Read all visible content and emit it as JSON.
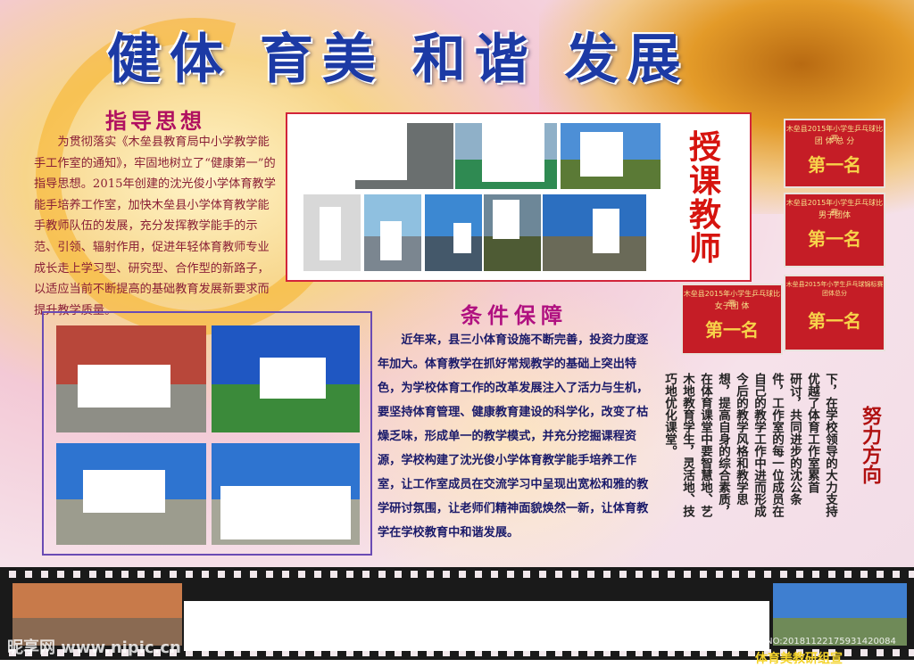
{
  "title": "健体 育美 和谐 发展",
  "guide": {
    "heading": "指导思想",
    "text": "为贯彻落实《木垒县教育局中小学教学能手工作室的通知》，牢固地树立了“健康第一”的指导思想。2015年创建的沈光俊小学体育教学能手培养工作室，加快木垒县小学体育教学能手教师队伍的发展，充分发挥教学能手的示范、引领、辐射作用，促进年轻体育教师专业成长走上学习型、研究型、合作型的新路子，以适应当前不断提高的基础教育发展新要求而提升教学质量。"
  },
  "teaching": {
    "title": "授课教师"
  },
  "awards": [
    {
      "line1": "木垒县2015年小学生乒乓球比赛",
      "line2": "团 体 总 分",
      "place": "第一名"
    },
    {
      "line1": "木垒县2015年小学生乒乓球比赛",
      "line2": "男子团体",
      "place": "第一名"
    },
    {
      "line1": "木垒县2015年小学生乒乓球比赛",
      "line2": "女子团 体",
      "place": "第一名"
    },
    {
      "line1": "木垒县2015年小学生乒乓球锦标赛团体总分",
      "line2": "",
      "place": "第一名"
    }
  ],
  "condition": {
    "heading": "条件保障",
    "text": "近年来，县三小体育设施不断完善，投资力度逐年加大。体育教学在抓好常规教学的基础上突出特色，为学校体育工作的改革发展注入了活力与生机，要坚持体育管理、健康教育建设的科学化，改变了枯燥乏味，形成单一的教学模式，并充分挖掘课程资源，学校构建了沈光俊小学体育教学能手培养工作室，让工作室成员在交流学习中呈现出宽松和雅的教学研讨氛围，让老师们精神面貌焕然一新，让体育教学在学校教育中和谐发展。"
  },
  "vertical_columns": [
    "下，在学校领导的大力支持",
    "优越了体育工作室累首",
    "研讨，共同进步的沈公条",
    "件，工作室的每一位成员在",
    "自己的教学工作中进而形成",
    "今后的教学风格和教学思",
    "想，提高自身的综合素质，",
    "在体育课堂中要智慧地、艺",
    "木地教育学生，灵活地、技",
    "巧地优化课堂。"
  ],
  "effort": {
    "text": "努力方向"
  },
  "watermark": {
    "site": "昵享网 www.nipic.cn",
    "id": "ID:26514770 NO:20181122175931420084",
    "bottom": "体育美教研组宣"
  }
}
